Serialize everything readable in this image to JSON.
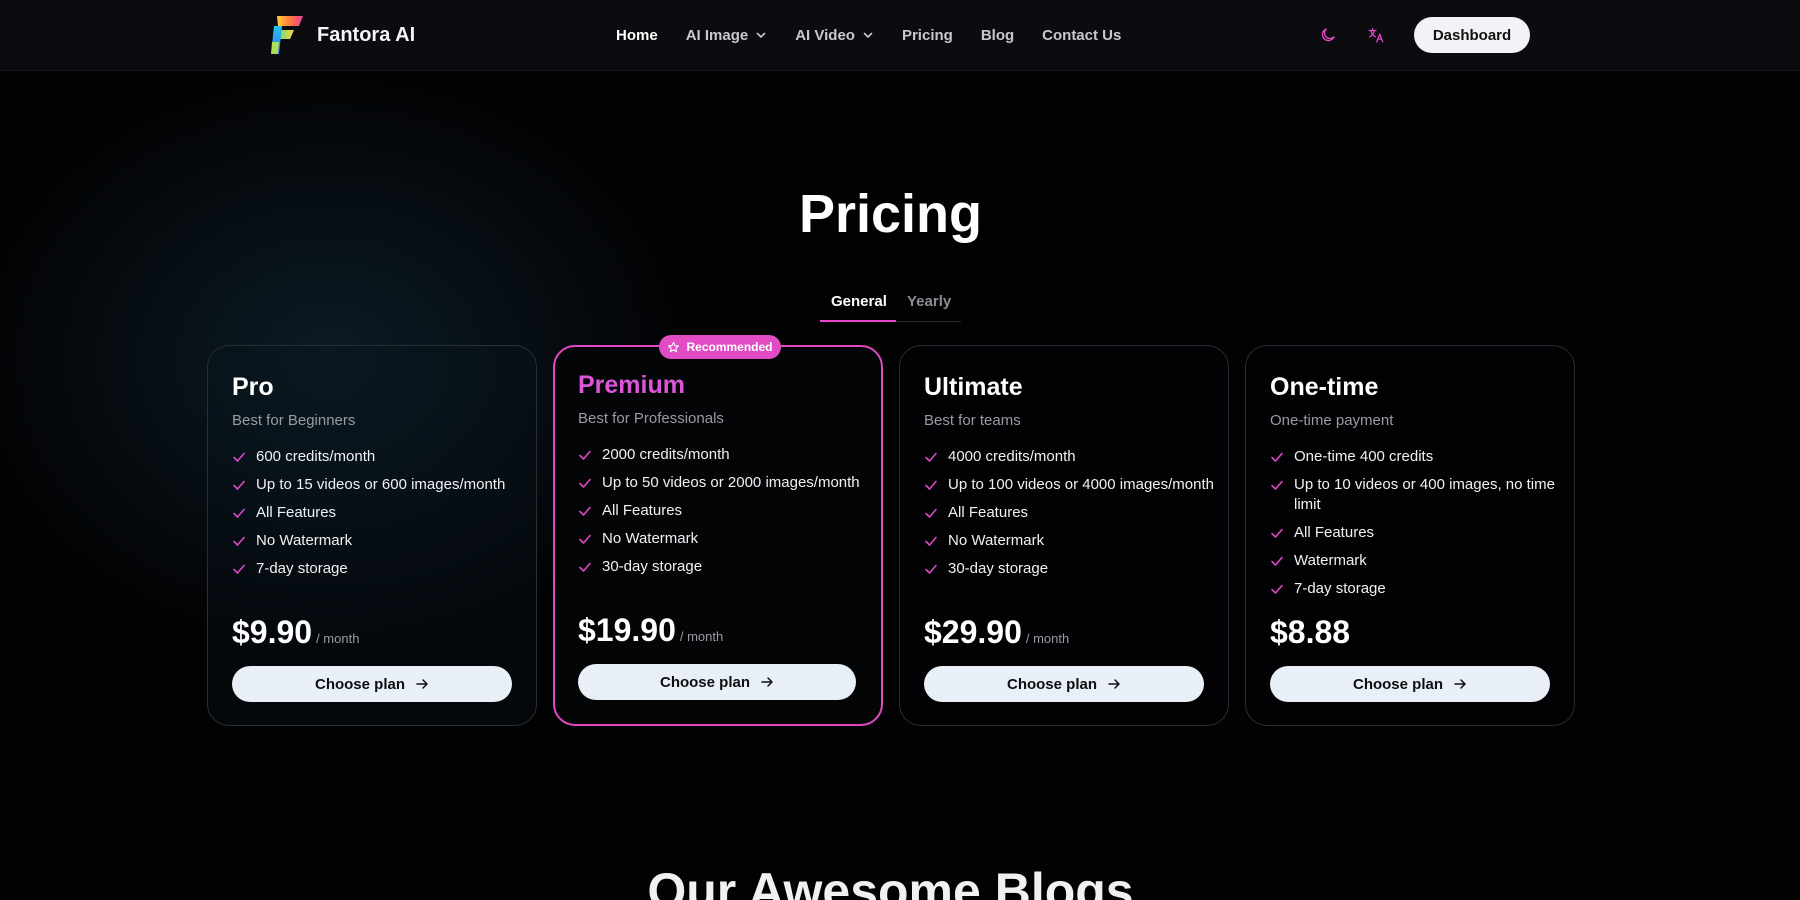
{
  "header": {
    "brand": "Fantora AI",
    "nav": [
      {
        "label": "Home",
        "active": true,
        "dropdown": false
      },
      {
        "label": "AI Image",
        "active": false,
        "dropdown": true
      },
      {
        "label": "AI Video",
        "active": false,
        "dropdown": true
      },
      {
        "label": "Pricing",
        "active": false,
        "dropdown": false
      },
      {
        "label": "Blog",
        "active": false,
        "dropdown": false
      },
      {
        "label": "Contact Us",
        "active": false,
        "dropdown": false
      }
    ],
    "theme_icon": "moon-icon",
    "language_icon": "translate-icon",
    "dashboard_label": "Dashboard"
  },
  "pricing": {
    "title": "Pricing",
    "tabs": [
      {
        "label": "General",
        "selected": true
      },
      {
        "label": "Yearly",
        "selected": false
      }
    ],
    "plans": [
      {
        "name": "Pro",
        "subtitle": "Best for Beginners",
        "features": [
          "600 credits/month",
          "Up to 15 videos or 600 images/month",
          "All Features",
          "No Watermark",
          "7-day storage"
        ],
        "price": "$9.90",
        "period": "/ month",
        "button": "Choose plan"
      },
      {
        "name": "Premium",
        "badge": "Recommended",
        "subtitle": "Best for Professionals",
        "features": [
          "2000 credits/month",
          "Up to 50 videos or 2000 images/month",
          "All Features",
          "No Watermark",
          "30-day storage"
        ],
        "price": "$19.90",
        "period": "/ month",
        "button": "Choose plan"
      },
      {
        "name": "Ultimate",
        "subtitle": "Best for teams",
        "features": [
          "4000 credits/month",
          "Up to 100 videos or 4000 images/month",
          "All Features",
          "No Watermark",
          "30-day storage"
        ],
        "price": "$29.90",
        "period": "/ month",
        "button": "Choose plan"
      },
      {
        "name": "One-time",
        "subtitle": "One-time payment",
        "features": [
          "One-time 400 credits",
          "Up to 10 videos or 400 images, no time limit",
          "All Features",
          "Watermark",
          "7-day storage"
        ],
        "price": "$8.88",
        "period": "",
        "button": "Choose plan"
      }
    ]
  },
  "blogs": {
    "title": "Our Awesome Blogs"
  },
  "colors": {
    "accent": "#e048c4",
    "background": "#020203",
    "button_bg": "#e9eff6"
  }
}
